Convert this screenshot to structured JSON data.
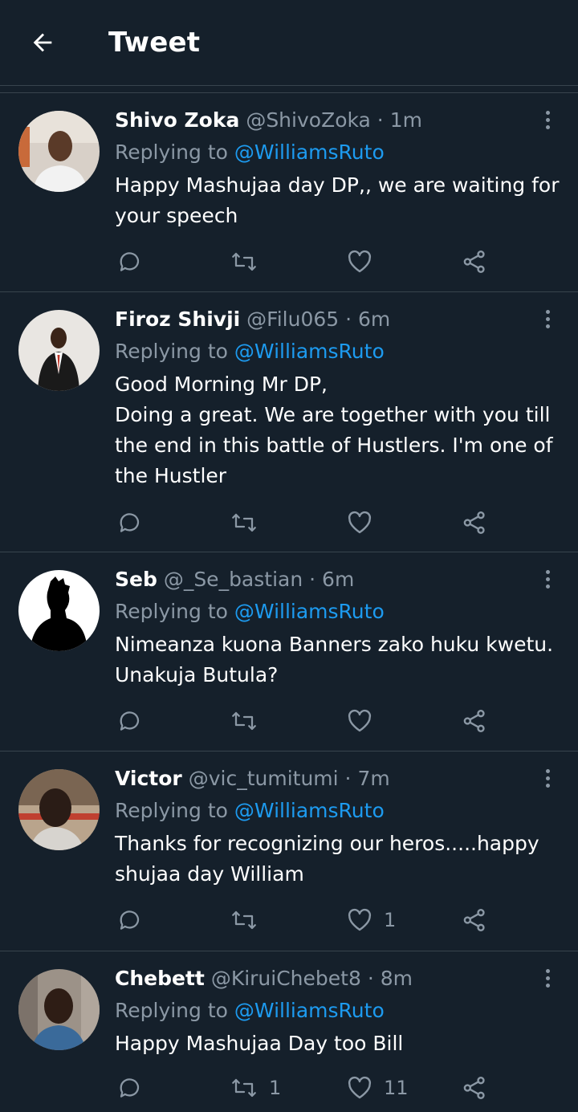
{
  "header": {
    "title": "Tweet"
  },
  "replying_label": "Replying to",
  "tweets": [
    {
      "name": "Shivo Zoka",
      "handle": "@ShivoZoka",
      "time": "1m",
      "reply_to": "@WilliamsRuto",
      "lines": [
        "Happy Mashujaa day DP,, we are waiting for",
        "your speech"
      ],
      "likes": ""
    },
    {
      "name": "Firoz Shivji",
      "handle": "@Filu065",
      "time": "6m",
      "reply_to": "@WilliamsRuto",
      "lines": [
        "Good Morning Mr DP,",
        "Doing a great. We are together with you till",
        "the end in this battle of Hustlers. I'm one of",
        "the Hustler"
      ],
      "likes": ""
    },
    {
      "name": "Seb",
      "handle": "@_Se_bastian",
      "time": "6m",
      "reply_to": "@WilliamsRuto",
      "lines": [
        "Nimeanza kuona Banners zako huku kwetu.",
        "Unakuja Butula?"
      ],
      "likes": ""
    },
    {
      "name": "Victor",
      "handle": "@vic_tumitumi",
      "time": "7m",
      "reply_to": "@WilliamsRuto",
      "lines": [
        "Thanks for recognizing our heros.....happy",
        "shujaa day William"
      ],
      "likes": "1"
    },
    {
      "name": "Chebett",
      "handle": "@KiruiChebet8",
      "time": "8m",
      "reply_to": "@WilliamsRuto",
      "lines": [
        "Happy Mashujaa Day too Bill"
      ],
      "retweets": "1",
      "likes": "11"
    }
  ],
  "icons": {
    "back": "arrow-left-icon",
    "more": "more-vertical-icon",
    "reply": "reply-icon",
    "retweet": "retweet-icon",
    "like": "heart-icon",
    "share": "share-icon"
  },
  "colors": {
    "background": "#15202b",
    "accent": "#1d9bf0",
    "muted": "#8b98a5",
    "divider": "#38444d"
  }
}
